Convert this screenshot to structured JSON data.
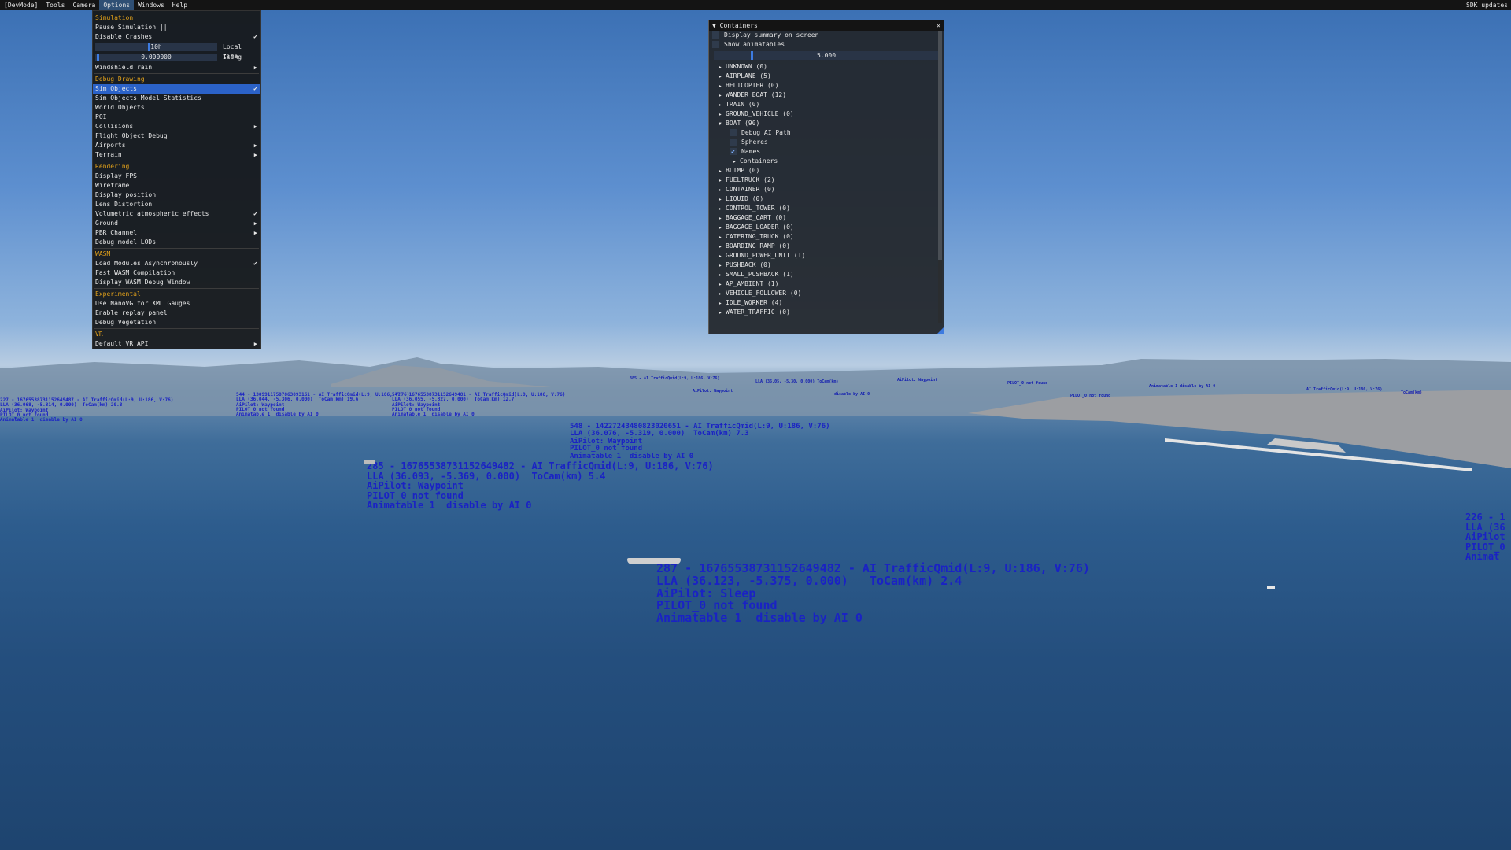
{
  "menubar": {
    "items": [
      "[DevMode]",
      "Tools",
      "Camera",
      "Options",
      "Windows",
      "Help"
    ],
    "active": "Options",
    "right_label": "SDK updates"
  },
  "options_menu": {
    "simulation": {
      "header": "Simulation",
      "pause": "Pause Simulation ||",
      "disable_crashes": "Disable Crashes",
      "time_value": "10h",
      "time_label": "Local time",
      "icing_value": "0.000000",
      "icing_label": "Icing",
      "windshield": "Windshield rain"
    },
    "debug_drawing": {
      "header": "Debug Drawing",
      "sim_objects": "Sim Objects",
      "model_stats": "Sim Objects Model Statistics",
      "world_objects": "World Objects",
      "poi": "POI",
      "collisions": "Collisions",
      "flight_object_debug": "Flight Object Debug",
      "airports": "Airports",
      "terrain": "Terrain"
    },
    "rendering": {
      "header": "Rendering",
      "fps": "Display FPS",
      "wireframe": "Wireframe",
      "position": "Display position",
      "lens": "Lens Distortion",
      "volumetric": "Volumetric atmospheric effects",
      "ground": "Ground",
      "pbr": "PBR Channel",
      "lods": "Debug model LODs"
    },
    "wasm": {
      "header": "WASM",
      "load_async": "Load Modules Asynchronously",
      "fast_compile": "Fast WASM Compilation",
      "debug_window": "Display WASM Debug Window"
    },
    "experimental": {
      "header": "Experimental",
      "nanovg": "Use NanoVG for XML Gauges",
      "replay": "Enable replay panel",
      "vegetation": "Debug Vegetation"
    },
    "vr": {
      "header": "VR",
      "api": "Default VR API"
    },
    "check_glyph": "✔",
    "arrow_glyph": "▶"
  },
  "containers_window": {
    "title": "Containers",
    "close": "✕",
    "display_summary": "Display summary on screen",
    "show_animatables": "Show animatables",
    "slider_value": "5.000",
    "expanded_glyph": "▼",
    "collapsed_glyph": "▶",
    "types": [
      "UNKNOWN (0)",
      "AIRPLANE (5)",
      "HELICOPTER (0)",
      "WANDER_BOAT (12)",
      "TRAIN (0)",
      "GROUND_VEHICLE (0)"
    ],
    "boat": {
      "label": "BOAT (90)",
      "debug_ai_path": "Debug AI Path",
      "spheres": "Spheres",
      "names": "Names",
      "names_checked": "✔",
      "containers": "Containers"
    },
    "types_after": [
      "BLIMP (0)",
      "FUELTRUCK (2)",
      "CONTAINER (0)",
      "LIQUID (0)",
      "CONTROL_TOWER (0)",
      "BAGGAGE_CART (0)",
      "BAGGAGE_LOADER (0)",
      "CATERING_TRUCK (0)",
      "BOARDING_RAMP (0)",
      "GROUND_POWER_UNIT (1)",
      "PUSHBACK (0)",
      "SMALL_PUSHBACK (1)",
      "AP_AMBIENT (1)",
      "VEHICLE_FOLLOWER (0)",
      "IDLE_WORKER (4)",
      "WATER_TRAFFIC (0)"
    ]
  },
  "ai_labels": {
    "main": "287 - 16765538731152649482 - AI TrafficQmid(L:9, U:186, V:76)\nLLA (36.123, -5.375, 0.000)   ToCam(km) 2.4\nAiPilot: Sleep\nPILOT_0 not found\nAnimatable 1  disable by AI 0",
    "mid": "285 - 16765538731152649482 - AI TrafficQmid(L:9, U:186, V:76)\nLLA (36.093, -5.369, 0.000)  ToCam(km) 5.4\nAiPilot: Waypoint\nPILOT_0 not found\nAnimatable 1  disable by AI 0",
    "right_edge": "226 - 1\nLLA (36\nAiPilot\nPILOT_0\nAnimat",
    "center": "548 - 14227243480823020651 - AI TrafficQmid(L:9, U:186, V:76)\nLLA (36.076, -5.319, 0.000)  ToCam(km) 7.3\nAiPilot: Waypoint\nPILOT_0 not found\nAnimatable 1  disable by AI 0",
    "left_far": "227 - 16765538731152649487 - AI TrafficQmid(L:9, U:186, V:76)\nLLA (36.068, -5.314, 0.000)  ToCam(km) 20.8\nAiPilot: Waypoint\nPILOT_0 not found\nAnimatable 1  disable by AI 0",
    "left_mid": "544 - 13099117507863093161 - AI TrafficQmid(L:9, U:186, V:76)\nLLA (36.044, -5.306, 0.000)  ToCam(km) 19.6\nAiPilot: Waypoint\nPILOT_0 not found\nAnimatable 1  disable by AI 0",
    "left_mid2": "547 - 16765538731152649481 - AI TrafficQmid(L:9, U:186, V:76)\nLLA (36.055, -5.327, 0.000)  ToCam(km) 12.7\nAiPilot: Waypoint\nPILOT_0 not found\nAnimatable 1  disable by AI 0"
  },
  "colors": {
    "label_blue": "#1a22c4",
    "menu_accent": "#e3a21a",
    "selection": "#2b62c8"
  }
}
